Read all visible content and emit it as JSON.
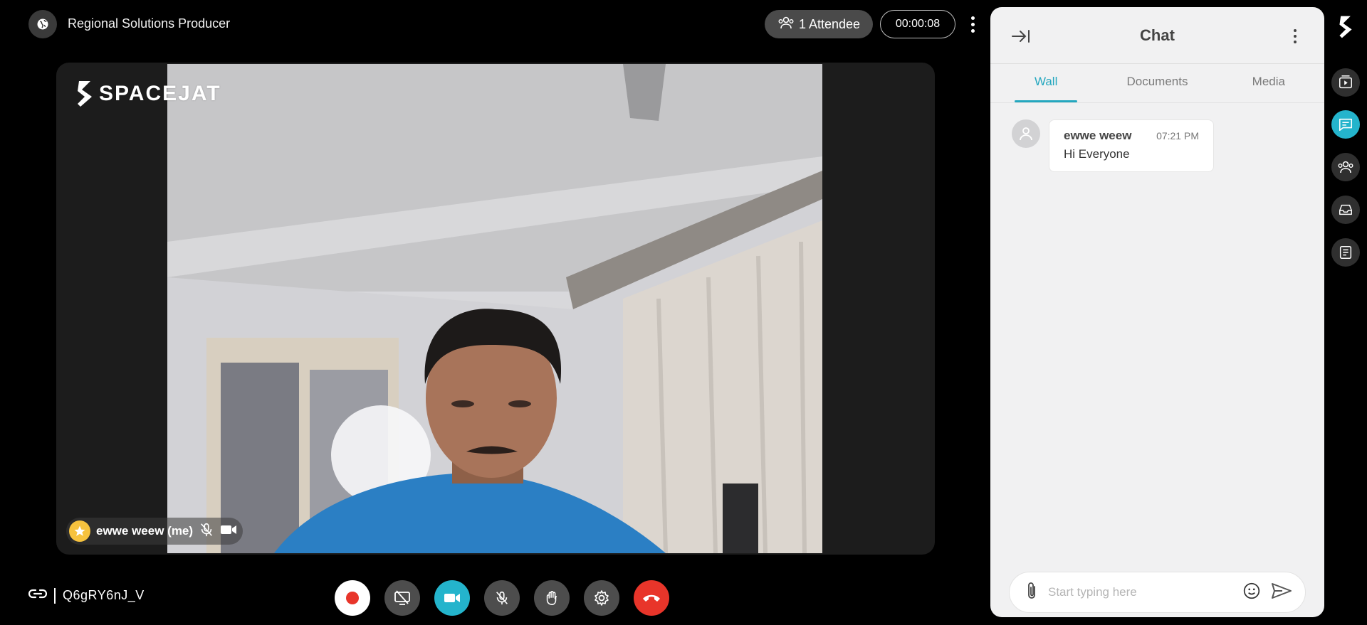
{
  "header": {
    "room_title": "Regional Solutions Producer",
    "attendees_label": "1 Attendee",
    "timer": "00:00:08"
  },
  "video": {
    "logo_text": "SPACEJAT",
    "participant_name": "ewwe weew (me)"
  },
  "footer": {
    "room_code": "Q6gRY6nJ_V",
    "controls": [
      "record",
      "screen-share-off",
      "camera",
      "microphone-off",
      "raise-hand",
      "settings",
      "end-call"
    ]
  },
  "chat": {
    "title": "Chat",
    "tabs": [
      {
        "label": "Wall",
        "active": true
      },
      {
        "label": "Documents",
        "active": false
      },
      {
        "label": "Media",
        "active": false
      }
    ],
    "messages": [
      {
        "author": "ewwe weew",
        "time": "07:21 PM",
        "text": "Hi Everyone"
      }
    ],
    "composer_placeholder": "Start typing here"
  },
  "colors": {
    "accent": "#24b4cc",
    "end_call": "#e8352a",
    "badge": "#f6c23e"
  }
}
